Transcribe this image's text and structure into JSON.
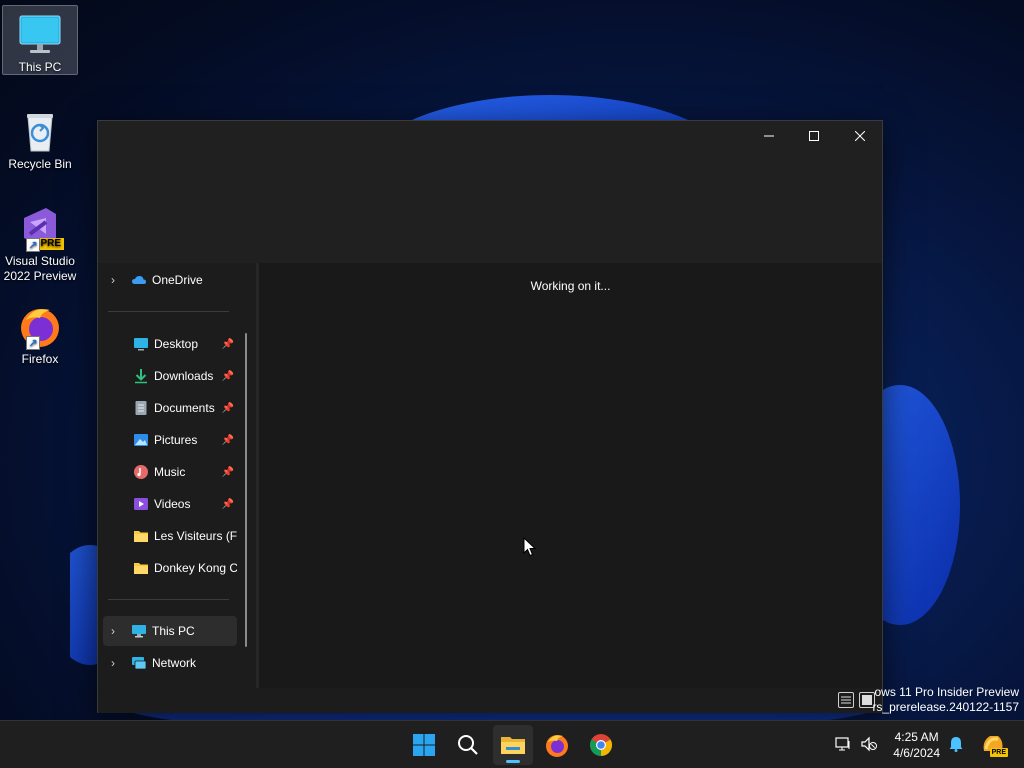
{
  "desktop": {
    "icons": [
      {
        "label": "This PC"
      },
      {
        "label": "Recycle Bin"
      },
      {
        "label": "Visual Studio 2022 Preview",
        "badge": "PRE"
      },
      {
        "label": "Firefox"
      }
    ]
  },
  "window": {
    "controls": {
      "minimize": "—",
      "maximize": "☐",
      "close": "✕"
    },
    "status_message": "Working on it...",
    "nav": {
      "onedrive": "OneDrive",
      "quick_access": [
        {
          "label": "Desktop",
          "icon": "desktop-icon"
        },
        {
          "label": "Downloads",
          "icon": "download-icon"
        },
        {
          "label": "Documents",
          "icon": "document-icon"
        },
        {
          "label": "Pictures",
          "icon": "pictures-icon"
        },
        {
          "label": "Music",
          "icon": "music-icon"
        },
        {
          "label": "Videos",
          "icon": "videos-icon"
        },
        {
          "label": "Les Visiteurs (F)",
          "icon": "folder-icon"
        },
        {
          "label": "Donkey Kong Co",
          "icon": "folder-icon"
        }
      ],
      "this_pc": "This PC",
      "network": "Network"
    }
  },
  "watermark": {
    "line1": "ows 11 Pro Insider Preview",
    "line2": "rs_prerelease.240122-1157"
  },
  "taskbar": {
    "apps": [
      "start-icon",
      "search-icon",
      "file-explorer-icon",
      "firefox-icon",
      "chrome-icon"
    ],
    "time": "4:25 AM",
    "date": "4/6/2024",
    "copilot_badge": "PRE"
  },
  "colors": {
    "accent": "#4cc2ff",
    "window_bg": "#1c1c1c",
    "folder": "#f7c948"
  }
}
